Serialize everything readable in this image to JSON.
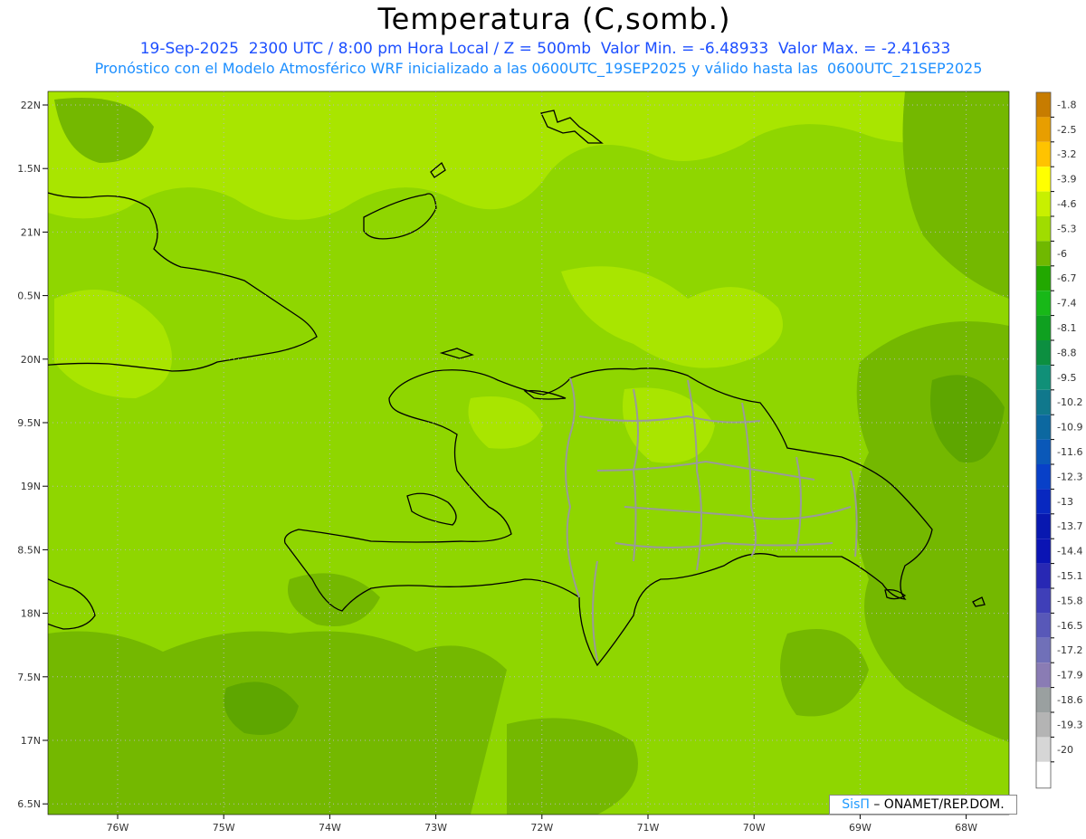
{
  "header": {
    "title": "Temperatura (C,somb.)",
    "line1": "19-Sep-2025  2300 UTC / 8:00 pm Hora Local / Z = 500mb  Valor Min. = -6.48933  Valor Max. = -2.41633",
    "line2": "Pronóstico con el Modelo Atmosférico WRF inicializado a las 0600UTC_19SEP2025 y válido hasta las  0600UTC_21SEP2025"
  },
  "map": {
    "lat_labels": [
      "22N",
      "1.5N",
      "21N",
      "0.5N",
      "20N",
      "9.5N",
      "19N",
      "8.5N",
      "18N",
      "7.5N",
      "17N",
      "6.5N"
    ],
    "lat_values": [
      22,
      21.5,
      21,
      20.5,
      20,
      19.5,
      19,
      18.5,
      18,
      17.5,
      17,
      16.5
    ],
    "lon_labels": [
      "76W",
      "75W",
      "74W",
      "73W",
      "72W",
      "71W",
      "70W",
      "69W",
      "68W"
    ],
    "lon_values": [
      -76,
      -75,
      -74,
      -73,
      -72,
      -71,
      -70,
      -69,
      -68
    ],
    "field_colors": {
      "light": "#a9e500",
      "medium": "#8fd600",
      "dark": "#74b800",
      "darker": "#5ea600"
    }
  },
  "legend": {
    "labels": [
      "-1.8",
      "-2.5",
      "-3.2",
      "-3.9",
      "-4.6",
      "-5.3",
      "-6",
      "-6.7",
      "-7.4",
      "-8.1",
      "-8.8",
      "-9.5",
      "-10.2",
      "-10.9",
      "-11.6",
      "-12.3",
      "-13",
      "-13.7",
      "-14.4",
      "-15.1",
      "-15.8",
      "-16.5",
      "-17.2",
      "-17.9",
      "-18.6",
      "-19.3",
      "-20"
    ],
    "colors": [
      "#c77c00",
      "#e89e00",
      "#ffc300",
      "#ffff00",
      "#c8f000",
      "#a0dc00",
      "#70b800",
      "#22a800",
      "#18b818",
      "#0fa020",
      "#0c8f40",
      "#109078",
      "#10788c",
      "#0c68a0",
      "#0a58b8",
      "#0840c8",
      "#0828c0",
      "#0818b0",
      "#0a14b4",
      "#2828b4",
      "#3f3fb8",
      "#5858b8",
      "#7070b8",
      "#8a7cb4",
      "#9aa0a0",
      "#b4b4b4",
      "#d6d6d6"
    ]
  },
  "credit": {
    "brand": "SisΠ",
    "text": " – ONAMET/REP.DOM."
  }
}
